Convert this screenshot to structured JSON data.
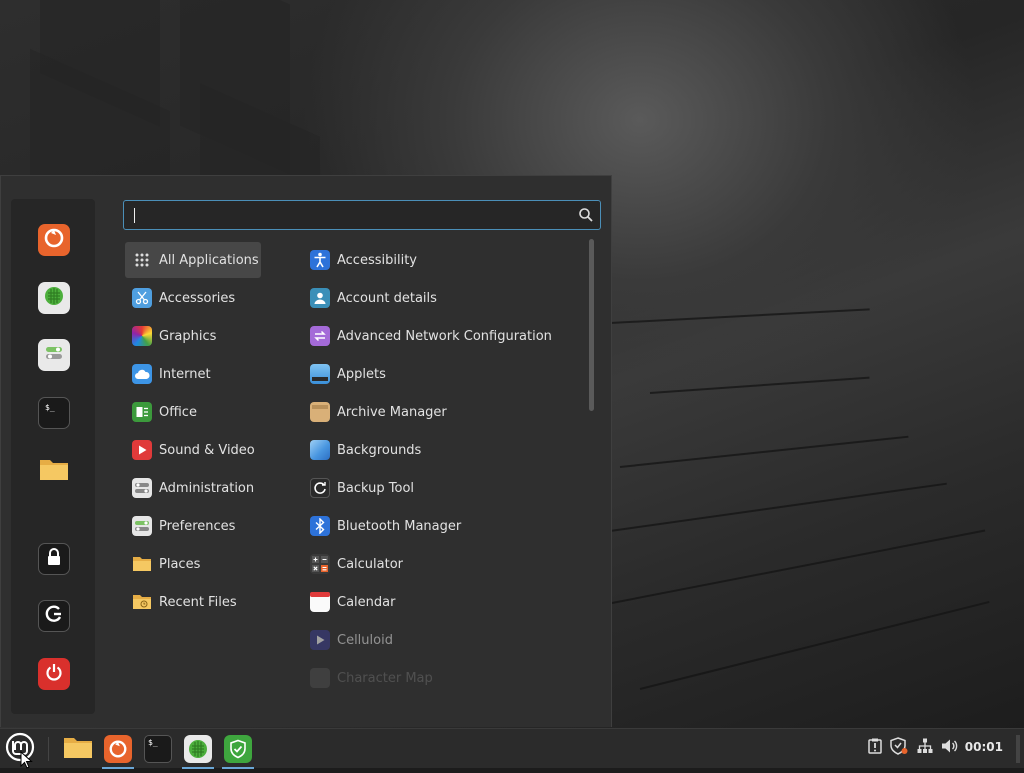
{
  "search": {
    "placeholder": "",
    "value": ""
  },
  "favorites": [
    {
      "name": "firefox-icon",
      "label": "Firefox"
    },
    {
      "name": "web-browser-icon",
      "label": "Web"
    },
    {
      "name": "settings-icon",
      "label": "Settings"
    },
    {
      "name": "terminal-icon",
      "label": "Terminal"
    },
    {
      "name": "folder-icon",
      "label": "Files"
    },
    {
      "name": "lock-icon",
      "label": "Lock"
    },
    {
      "name": "logout-icon",
      "label": "Logout"
    },
    {
      "name": "power-icon",
      "label": "Power"
    }
  ],
  "categories": [
    {
      "label": "All Applications",
      "icon": "grid-icon"
    },
    {
      "label": "Accessories",
      "icon": "scissors-icon"
    },
    {
      "label": "Graphics",
      "icon": "graphics-icon"
    },
    {
      "label": "Internet",
      "icon": "cloud-icon"
    },
    {
      "label": "Office",
      "icon": "office-icon"
    },
    {
      "label": "Sound & Video",
      "icon": "play-icon"
    },
    {
      "label": "Administration",
      "icon": "admin-icon"
    },
    {
      "label": "Preferences",
      "icon": "preferences-icon"
    },
    {
      "label": "Places",
      "icon": "folder-icon"
    },
    {
      "label": "Recent Files",
      "icon": "recent-folder-icon"
    }
  ],
  "apps": [
    {
      "label": "Accessibility",
      "icon": "accessibility-icon"
    },
    {
      "label": "Account details",
      "icon": "account-icon"
    },
    {
      "label": "Advanced Network Configuration",
      "icon": "network-config-icon"
    },
    {
      "label": "Applets",
      "icon": "applets-icon"
    },
    {
      "label": "Archive Manager",
      "icon": "archive-icon"
    },
    {
      "label": "Backgrounds",
      "icon": "backgrounds-icon"
    },
    {
      "label": "Backup Tool",
      "icon": "backup-icon"
    },
    {
      "label": "Bluetooth Manager",
      "icon": "bluetooth-icon"
    },
    {
      "label": "Calculator",
      "icon": "calculator-icon"
    },
    {
      "label": "Calendar",
      "icon": "calendar-icon"
    },
    {
      "label": "Celluloid",
      "icon": "celluloid-icon"
    },
    {
      "label": "Character Map",
      "icon": "character-map-icon"
    }
  ],
  "taskbar": {
    "clock": "00:01",
    "launchers": [
      "files",
      "firefox",
      "terminal",
      "web-browser",
      "update-manager"
    ]
  },
  "colors": {
    "accent": "#6aa6d6",
    "search_border": "#4b8fb8",
    "firefox": "#e8642c",
    "power": "#d9302c",
    "folder": "#f2c25a"
  }
}
